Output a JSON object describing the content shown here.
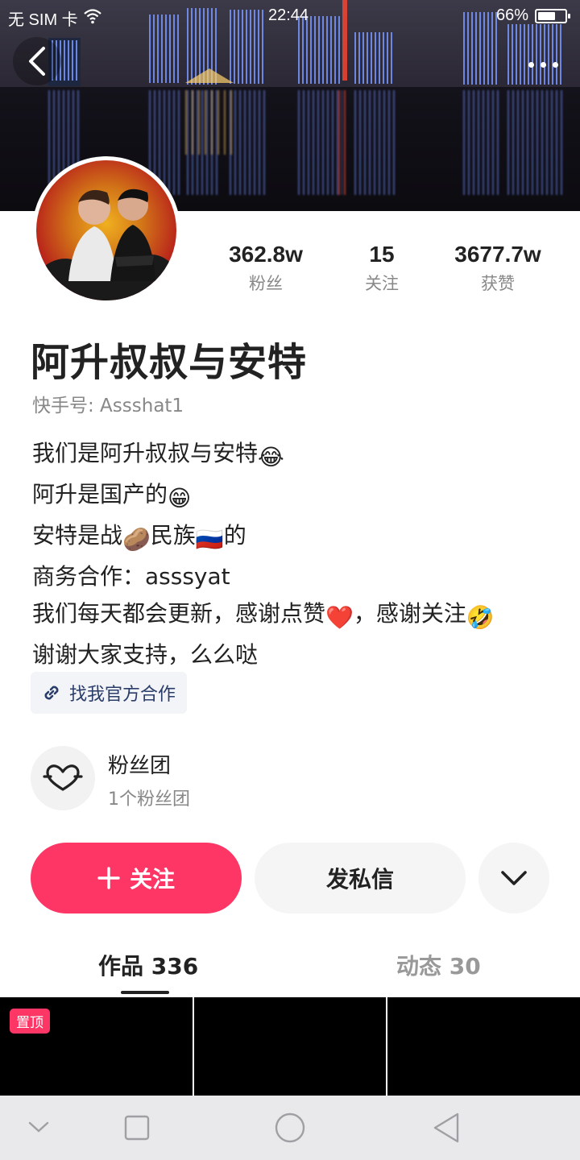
{
  "status_bar": {
    "carrier": "无 SIM 卡",
    "time": "22:44",
    "battery": "66%",
    "battery_level": 0.66
  },
  "profile": {
    "name": "阿升叔叔与安特",
    "user_id": "快手号: Assshat1",
    "stats": [
      {
        "value": "362.8w",
        "label": "粉丝"
      },
      {
        "value": "15",
        "label": "关注"
      },
      {
        "value": "3677.7w",
        "label": "获赞"
      }
    ],
    "bio": [
      {
        "text": "我们是阿升叔叔与安特",
        "emoji": "😂"
      },
      {
        "text": "阿升是国产的",
        "emoji": "😁"
      },
      {
        "pre": "安特是战",
        "emoji1": "🥔",
        "mid": "民族",
        "emoji2": "🇷🇺",
        "post": "的"
      },
      {
        "text": "商务合作：asssyat"
      },
      {
        "pre": "我们每天都会更新，感谢点赞",
        "emoji1": "❤️",
        "post": "，感谢关注",
        "emoji2": "🤣"
      },
      {
        "text": "谢谢大家支持，么么哒"
      }
    ],
    "link_label": "找我官方合作"
  },
  "fan_group": {
    "title": "粉丝团",
    "subtitle": "1个粉丝团"
  },
  "actions": {
    "follow_label": "关注",
    "message_label": "发私信"
  },
  "tabs": [
    {
      "label": "作品 336",
      "active": true
    },
    {
      "label": "动态 30",
      "active": false
    }
  ],
  "grid": {
    "pinned_label": "置顶"
  },
  "colors": {
    "accent": "#fe3666",
    "link": "#2a3d6a"
  }
}
